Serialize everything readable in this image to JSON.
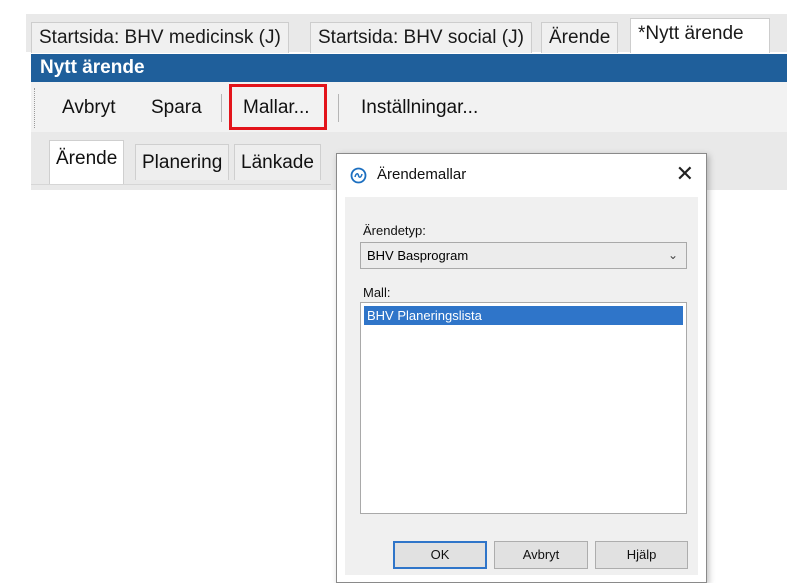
{
  "doc_tabs": [
    {
      "label": "Startsida: BHV medicinsk (J)"
    },
    {
      "label": "Startsida: BHV social (J)"
    },
    {
      "label": "Ärende"
    },
    {
      "label": "*Nytt ärende"
    }
  ],
  "window": {
    "title": "Nytt ärende"
  },
  "toolbar": {
    "cancel_label": "Avbryt",
    "save_label": "Spara",
    "templates_label": "Mallar...",
    "settings_label": "Inställningar..."
  },
  "sub_tabs": [
    {
      "label": "Ärende"
    },
    {
      "label": "Planering"
    },
    {
      "label": "Länkade"
    }
  ],
  "dialog": {
    "title": "Ärendemallar",
    "case_type_label": "Ärendetyp:",
    "case_type_value": "BHV Basprogram",
    "template_label": "Mall:",
    "templates": [
      "BHV Planeringslista"
    ],
    "ok_label": "OK",
    "cancel_label": "Avbryt",
    "help_label": "Hjälp"
  },
  "colors": {
    "titlebar_bg": "#1f5f9b",
    "highlight_border": "#e3141b",
    "selection_bg": "#2f75c9"
  },
  "icons": {
    "dialog_icon": "template-icon",
    "close": "close-icon",
    "dropdown": "chevron-down-icon"
  }
}
